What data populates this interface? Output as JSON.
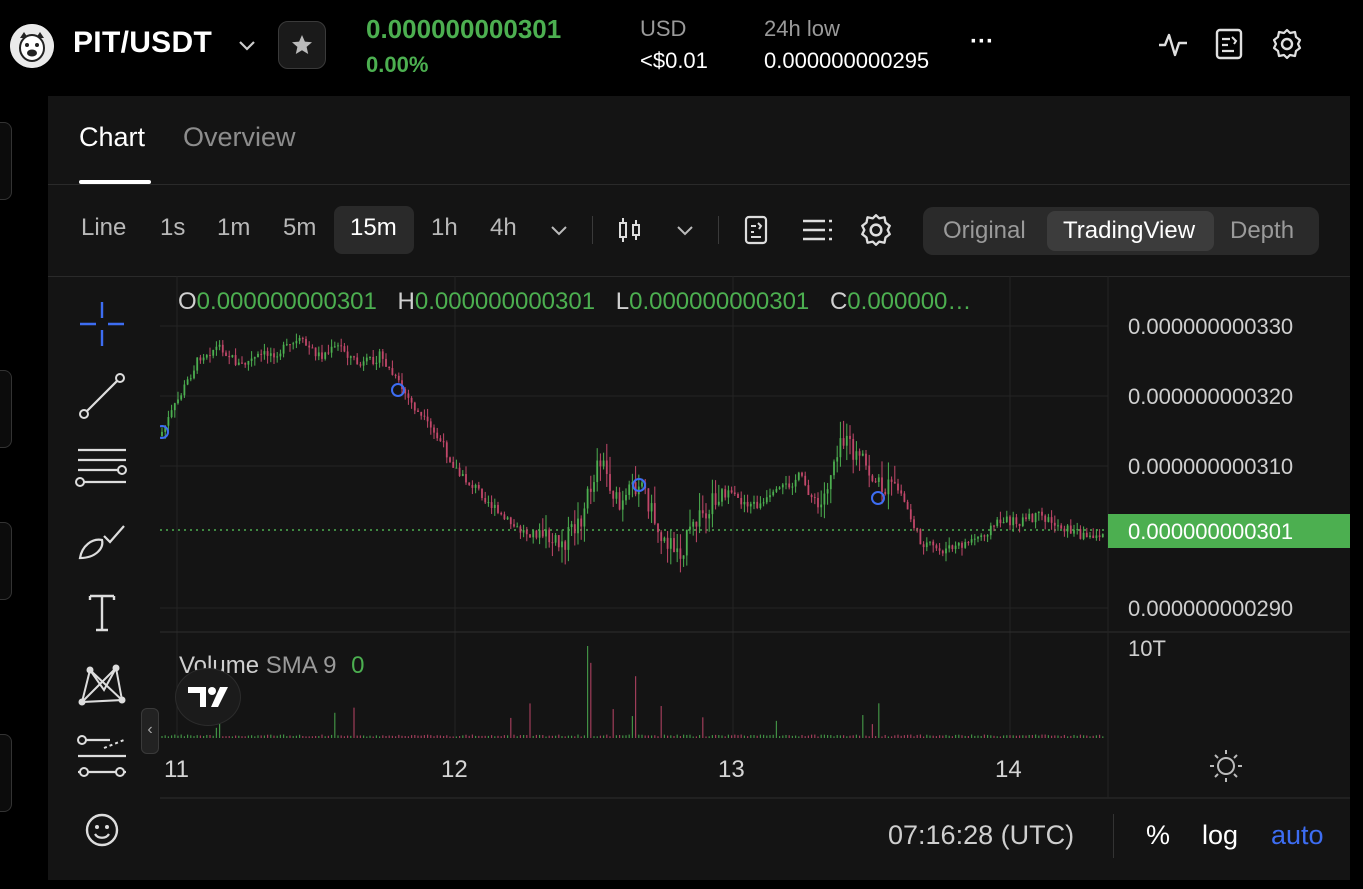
{
  "header": {
    "pair": "PIT/USDT",
    "last_price": "0.000000000301",
    "change_pct": "0.00%",
    "usd_label": "USD",
    "usd_value": "<$0.01",
    "low_label": "24h low",
    "low_value": "0.000000000295",
    "more_label": "···"
  },
  "tabs": [
    {
      "label": "Chart",
      "active": true
    },
    {
      "label": "Overview",
      "active": false
    }
  ],
  "toolbar": {
    "intervals": [
      "Line",
      "1s",
      "1m",
      "5m",
      "15m",
      "1h",
      "4h"
    ],
    "selected_interval": "15m",
    "views": [
      "Original",
      "TradingView",
      "Depth"
    ],
    "selected_view": "TradingView"
  },
  "legend": {
    "o_key": "O",
    "o_val": "0.000000000301",
    "h_key": "H",
    "h_val": "0.000000000301",
    "l_key": "L",
    "l_val": "0.000000000301",
    "c_key": "C",
    "c_val": "0.000000…"
  },
  "price_axis": {
    "ticks": [
      "0.000000000330",
      "0.000000000320",
      "0.000000000310",
      "0.000000000290"
    ],
    "current_label": "0.000000000301",
    "volume_tick": "10T"
  },
  "volume_pane": {
    "name": "Volume",
    "indicator": "SMA 9",
    "value": "0"
  },
  "date_axis": {
    "labels": [
      "11",
      "12",
      "13",
      "14"
    ]
  },
  "footer": {
    "time": "07:16:28 (UTC)",
    "percent": "%",
    "log": "log",
    "auto": "auto"
  },
  "colors": {
    "up": "#4caf50",
    "down": "#c2476a",
    "accent": "#3d6df2"
  },
  "icons": {
    "top": [
      "activity-icon",
      "report-icon",
      "settings-gear-icon"
    ],
    "drawing_tools": [
      "crosshair-icon",
      "trendline-icon",
      "fib-lines-icon",
      "brush-icon",
      "text-icon",
      "pattern-icon",
      "measure-icon",
      "emoji-icon"
    ]
  },
  "chart_data": {
    "type": "candlestick",
    "x_ticks": [
      "11",
      "12",
      "13",
      "14"
    ],
    "y_ticks": [
      3.3e-10,
      3.2e-10,
      3.1e-10,
      2.9e-10
    ],
    "ylim": [
      2.88e-10,
      3.33e-10
    ],
    "last_value": 3.01e-10,
    "grid": true,
    "segments_note": "day 11 high ~0.000000000325, falls to ~0.000000000303 on day 12, volatile ~0.000000000295-0.000000000318 on day 12-13, flat ~0.000000000301 on day 14"
  }
}
